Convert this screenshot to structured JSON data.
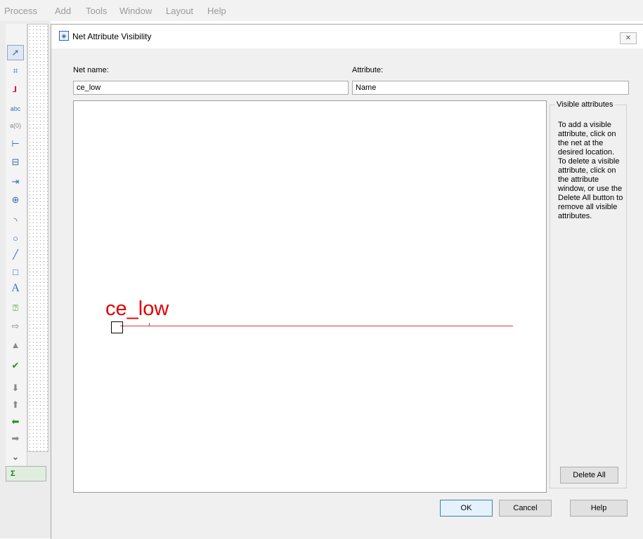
{
  "menu": [
    "Process",
    "Add",
    "Tools",
    "Window",
    "Layout",
    "Help"
  ],
  "toolbar_icons": [
    "pointer-icon",
    "net-icon",
    "pin-icon",
    "abc-label-icon",
    "attribute-icon",
    "bus-tap-icon",
    "bus-entry-icon",
    "net-name-icon",
    "symbol-icon",
    "arc-icon",
    "circle-icon",
    "line-icon",
    "rectangle-icon",
    "text-icon",
    "help-icon",
    "io-marker-icon",
    "tree-icon",
    "check-icon",
    "push-down-icon",
    "pop-up-icon",
    "back-icon",
    "forward-icon",
    "more-chevron-icon"
  ],
  "sidebar_bottom": {
    "sigma": "Σ"
  },
  "dialog": {
    "title": "Net Attribute Visibility",
    "close": "✕",
    "net_name_label": "Net name:",
    "net_name_value": "ce_low",
    "attribute_label": "Attribute:",
    "attribute_value": "Name",
    "canvas_net_label": "ce_low",
    "visible_group_title": "Visible attributes",
    "instructions": "To add a visible attribute, click on the net at the desired location.  To delete a visible attribute, click on the attribute window, or use the Delete All button to remove all visible attributes.",
    "delete_all_label": "Delete All",
    "ok_label": "OK",
    "cancel_label": "Cancel",
    "help_label": "Help"
  },
  "colors": {
    "net": "#e00000",
    "accent": "#3c7fb1"
  }
}
